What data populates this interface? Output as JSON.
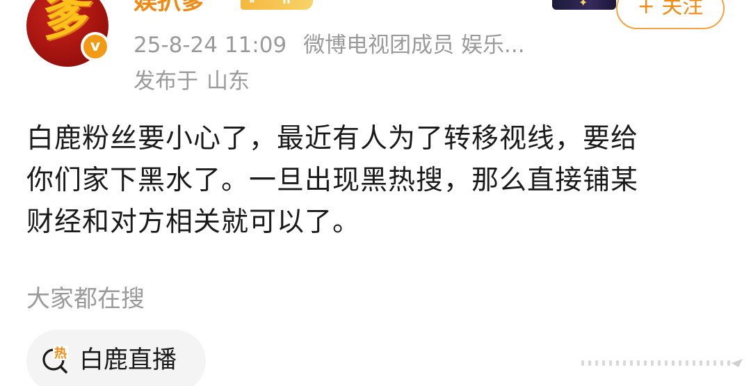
{
  "header": {
    "username": "娱扒爹",
    "level": "II",
    "follow_label": "+ 关注",
    "timestamp": "25-8-24 11:09",
    "source": "微博电视团成员 娱乐...",
    "location_prefix": "发布于",
    "location": "山东",
    "avatar_glyph": "爹",
    "badge_glyph": "v"
  },
  "post": {
    "lines": [
      "白鹿粉丝要小心了，最近有人为了转移视线，要给",
      "你们家下黑水了。一旦出现黑热搜，那么直接铺某",
      "财经和对方相关就可以了。"
    ]
  },
  "trending": {
    "title": "大家都在搜",
    "chip_label": "白鹿直播",
    "chip_icon": "search-hot-icon",
    "icon_glyph": "热"
  },
  "colors": {
    "accent_orange": "#f08a12",
    "meta_gray": "#9a9a9a",
    "body_text": "#1a1a1a",
    "chip_bg": "#f4f4f4"
  }
}
